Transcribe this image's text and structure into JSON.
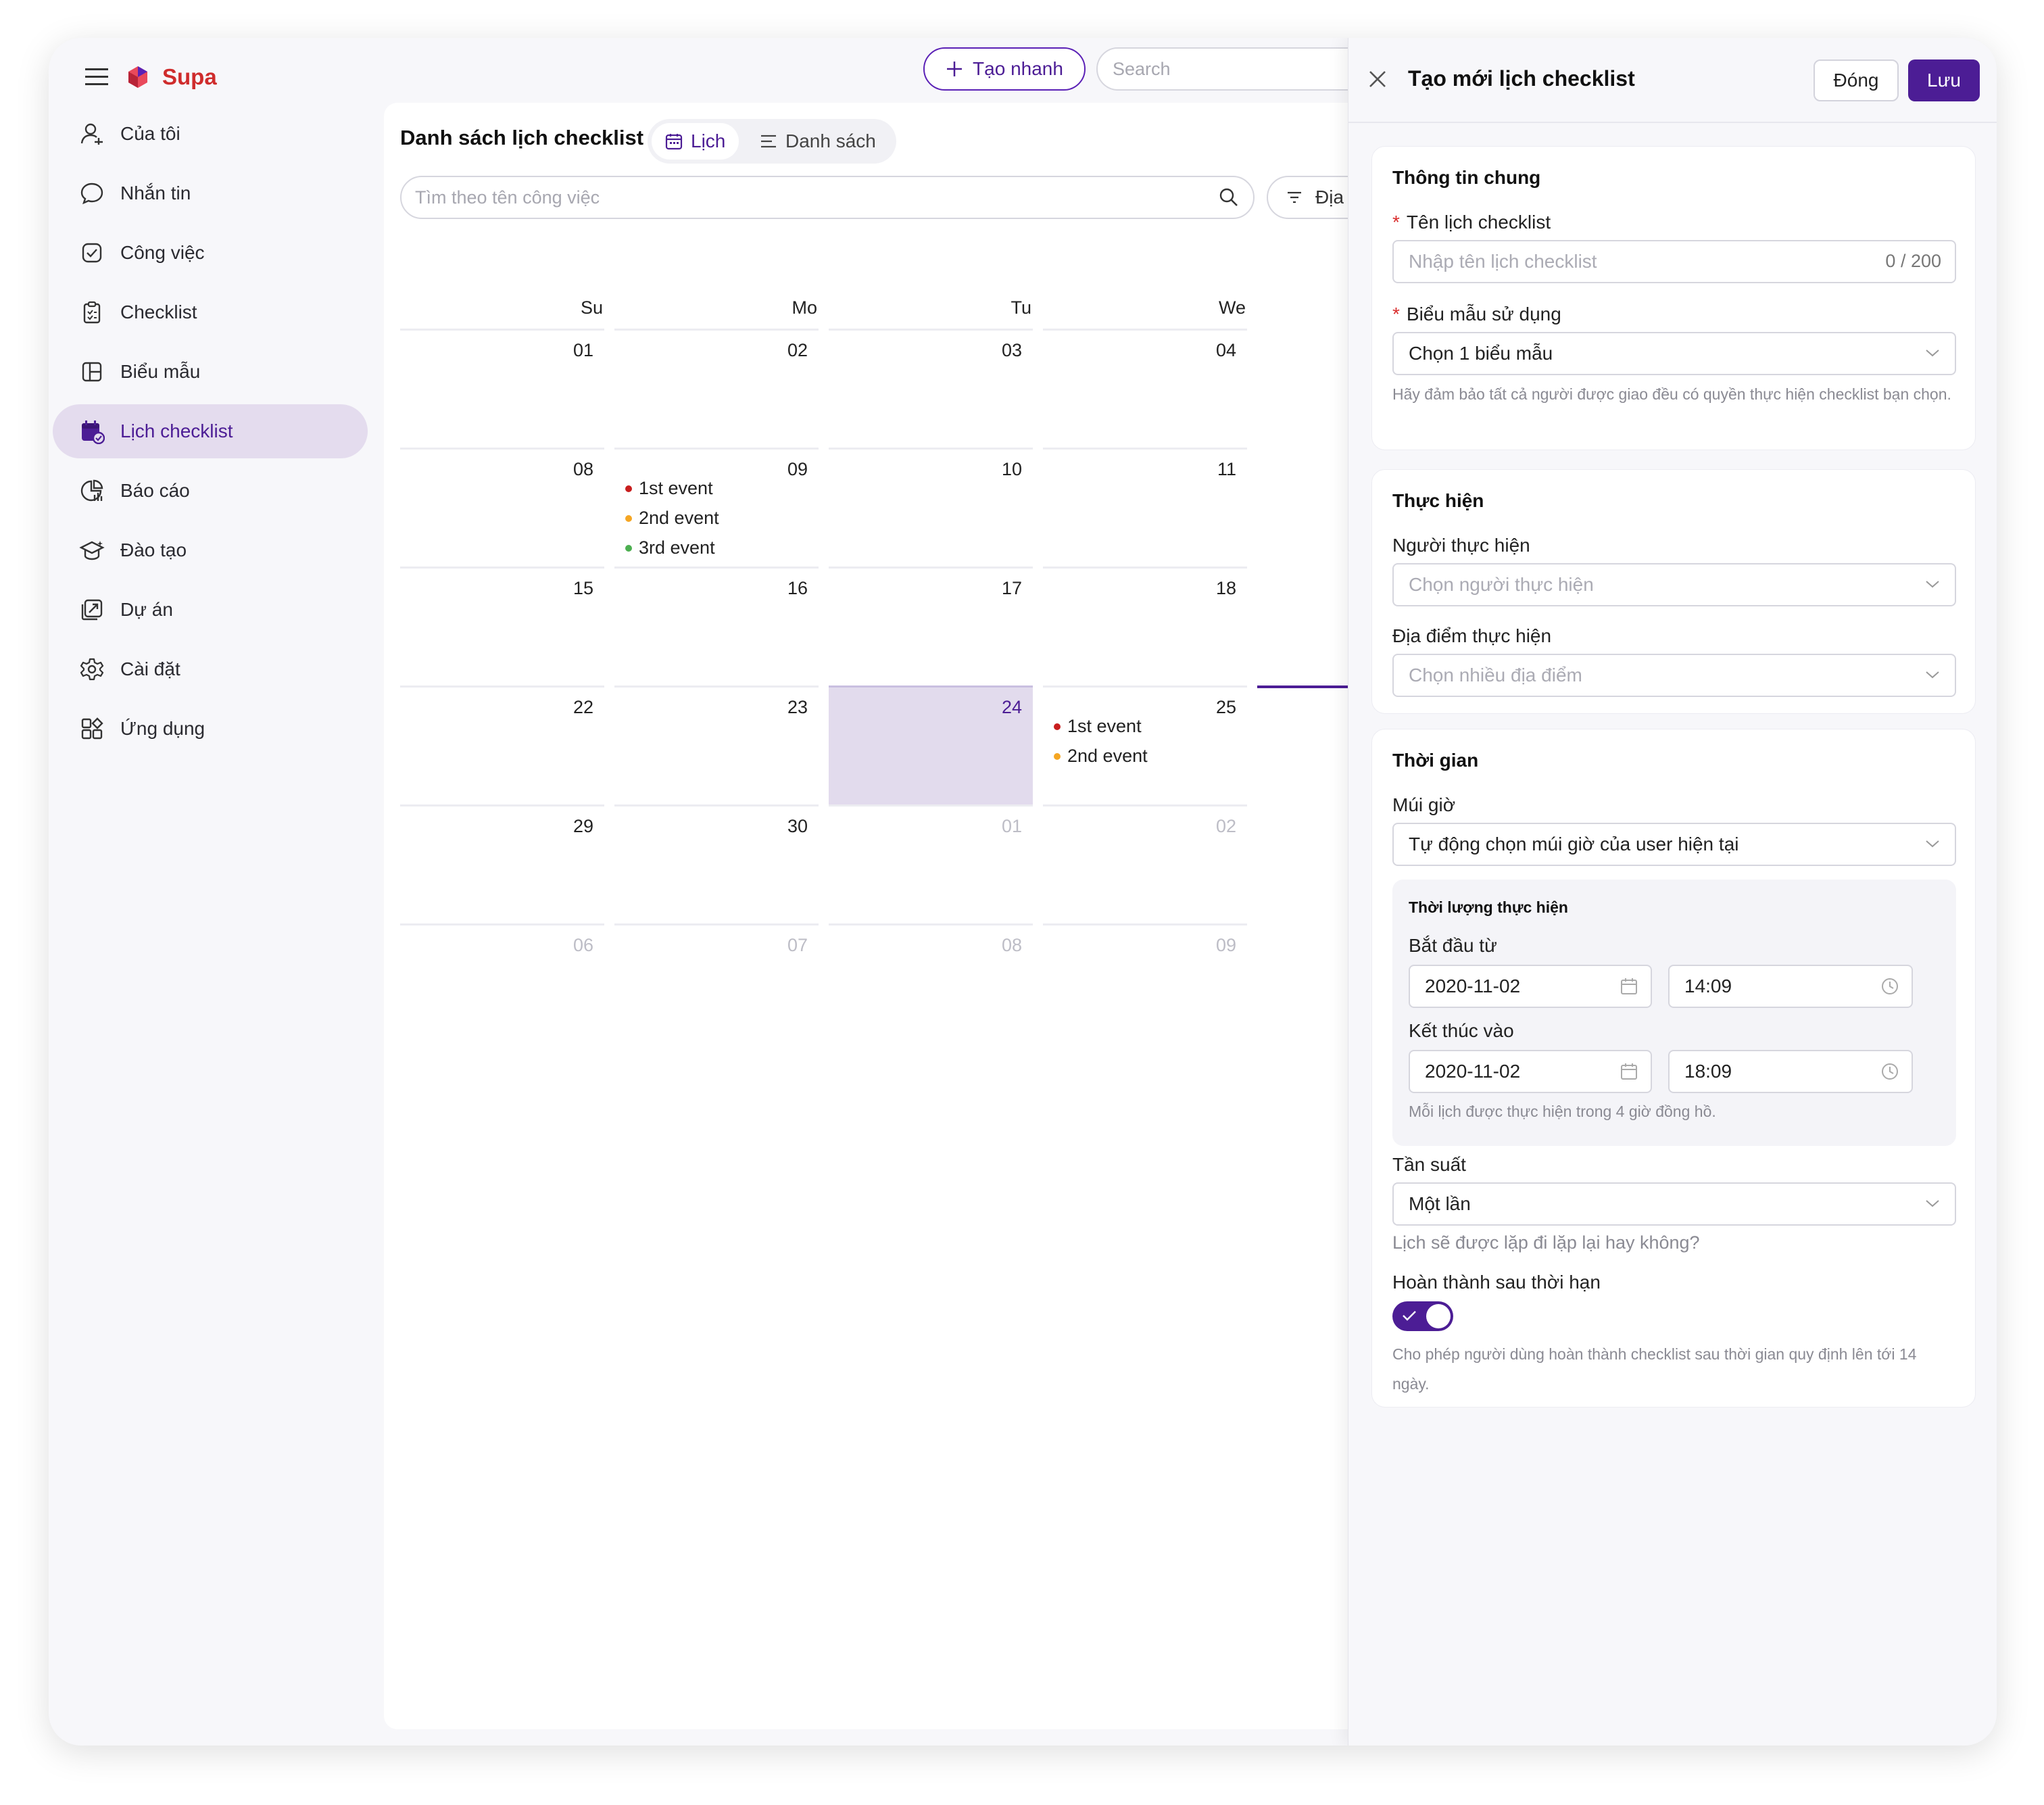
{
  "app": {
    "brand": "Supa"
  },
  "header": {
    "quick_create": "Tạo nhanh",
    "search_placeholder": "Search"
  },
  "sidebar": {
    "items": [
      {
        "label": "Của tôi",
        "icon": "user-icon"
      },
      {
        "label": "Nhắn tin",
        "icon": "chat-icon"
      },
      {
        "label": "Công việc",
        "icon": "task-check-icon"
      },
      {
        "label": "Checklist",
        "icon": "clipboard-icon"
      },
      {
        "label": "Biểu mẫu",
        "icon": "form-icon"
      },
      {
        "label": "Lịch checklist",
        "icon": "calendar-checklist-icon",
        "active": true
      },
      {
        "label": "Báo cáo",
        "icon": "report-icon"
      },
      {
        "label": "Đào tạo",
        "icon": "training-icon"
      },
      {
        "label": "Dự án",
        "icon": "project-icon"
      },
      {
        "label": "Cài đặt",
        "icon": "gear-icon"
      },
      {
        "label": "Ứng dụng",
        "icon": "apps-icon"
      }
    ]
  },
  "main": {
    "title": "Danh sách lịch checklist",
    "view_calendar": "Lịch",
    "view_list": "Danh sách",
    "task_search_placeholder": "Tìm theo tên công việc",
    "filter_label": "Địa",
    "days": [
      "Su",
      "Mo",
      "Tu",
      "We"
    ],
    "weeks": [
      [
        "01",
        "02",
        "03",
        "04"
      ],
      [
        "08",
        "09",
        "10",
        "11"
      ],
      [
        "15",
        "16",
        "17",
        "18"
      ],
      [
        "22",
        "23",
        "24",
        "25"
      ],
      [
        "29",
        "30",
        "01",
        "02"
      ],
      [
        "06",
        "07",
        "08",
        "09"
      ]
    ],
    "today": "24",
    "events_09": [
      "1st event",
      "2nd event",
      "3rd event"
    ],
    "events_25": [
      "1st event",
      "2nd event"
    ],
    "event_colors": [
      "#c81e1e",
      "#f5a623",
      "#4caf50"
    ]
  },
  "drawer": {
    "title": "Tạo mới lịch checklist",
    "close_label": "Đóng",
    "save_label": "Lưu",
    "general": {
      "title": "Thông tin chung",
      "name_label": "Tên lịch checklist",
      "name_placeholder": "Nhập tên lịch checklist",
      "name_counter": "0 / 200",
      "form_label": "Biểu mẫu sử dụng",
      "form_value": "Chọn 1 biểu mẫu",
      "form_help": "Hãy đảm bảo tất cả người được giao đều có quyền thực hiện checklist bạn chọn."
    },
    "execution": {
      "title": "Thực hiện",
      "assignee_label": "Người thực hiện",
      "assignee_placeholder": "Chọn người thực hiện",
      "location_label": "Địa điểm thực hiện",
      "location_placeholder": "Chọn nhiều địa điểm"
    },
    "time": {
      "title": "Thời gian",
      "timezone_label": "Múi giờ",
      "timezone_value": "Tự động chọn múi giờ của user hiện tại",
      "duration_title": "Thời lượng thực hiện",
      "start_label": "Bắt đầu từ",
      "start_date": "2020-11-02",
      "start_time": "14:09",
      "end_label": "Kết thúc vào",
      "end_date": "2020-11-02",
      "end_time": "18:09",
      "duration_help": "Mỗi lịch được thực hiện trong 4 giờ đồng hồ.",
      "frequency_label": "Tần suất",
      "frequency_value": "Một lần",
      "frequency_help": "Lịch sẽ được lặp đi lặp lại hay không?",
      "late_label": "Hoàn thành sau thời hạn",
      "late_enabled": true,
      "late_help": "Cho phép người dùng hoàn thành checklist sau thời gian quy định lên tới 14 ngày."
    }
  },
  "colors": {
    "accent": "#4c1d95",
    "accent_light": "#e4dcee",
    "brand": "#cf2c2c"
  }
}
